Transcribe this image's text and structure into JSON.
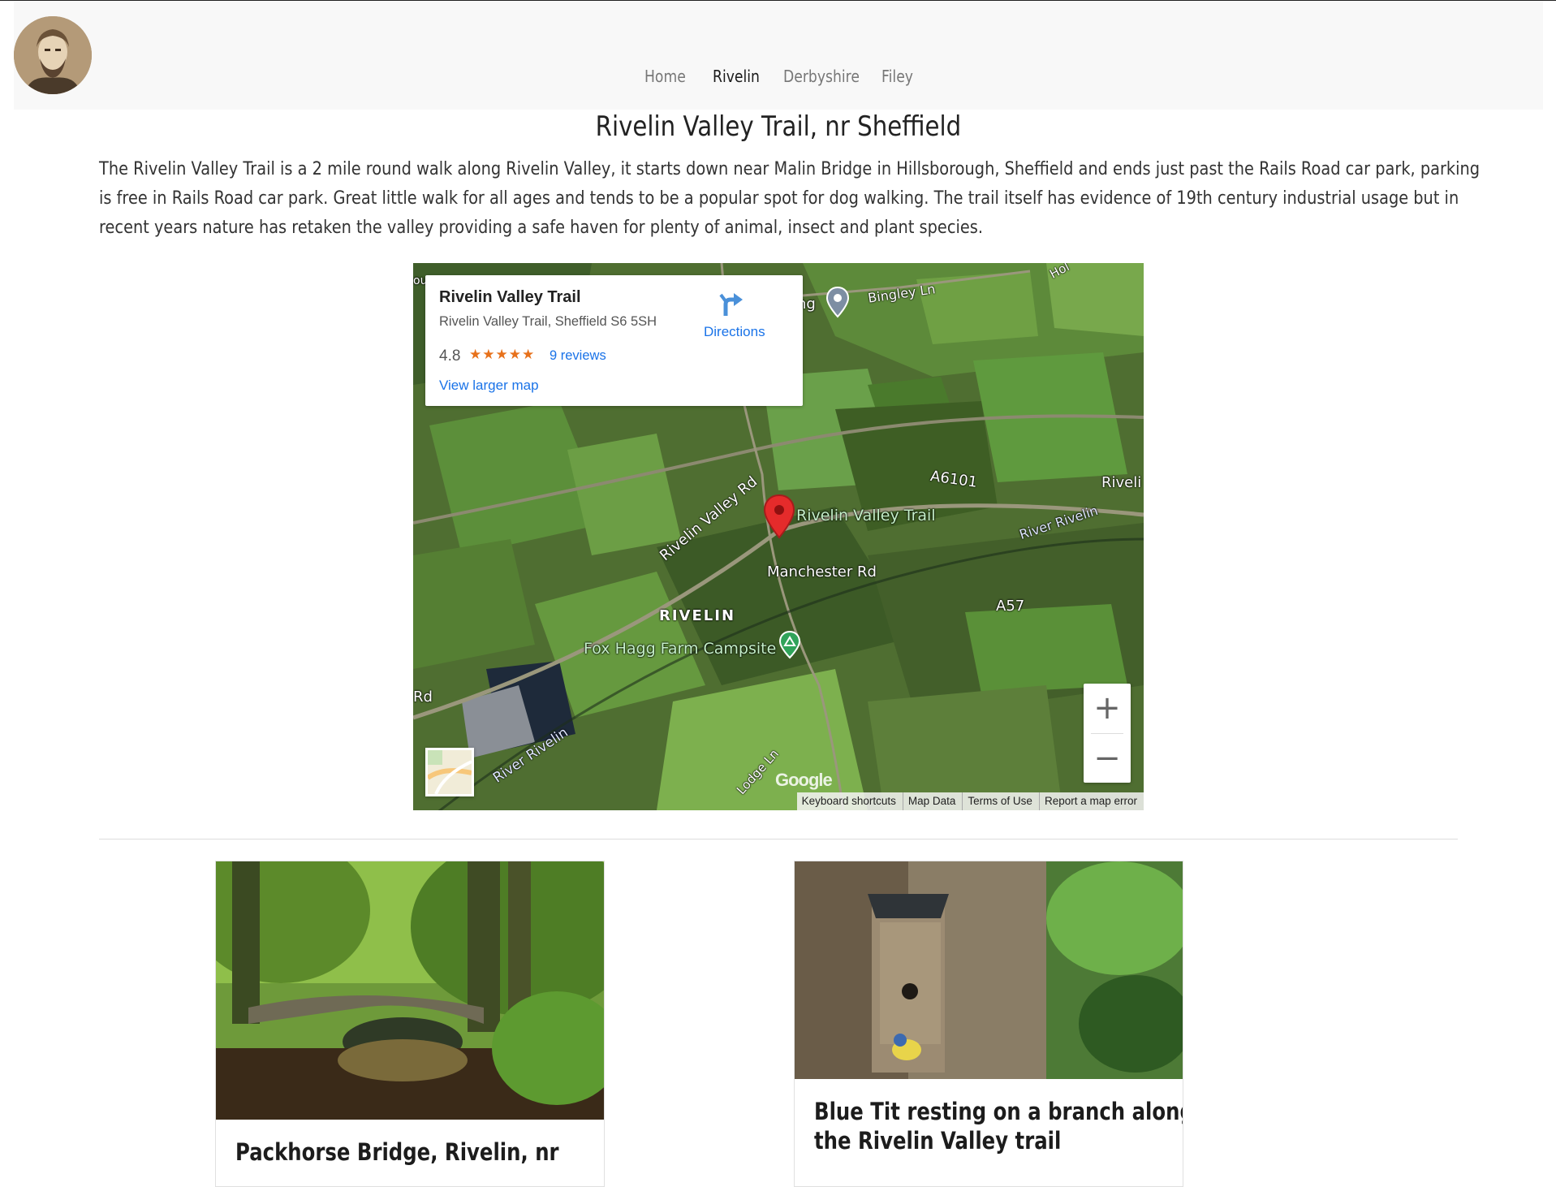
{
  "nav": {
    "items": [
      {
        "label": "Home"
      },
      {
        "label": "Rivelin"
      },
      {
        "label": "Derbyshire"
      },
      {
        "label": "Filey"
      }
    ],
    "active": "Rivelin"
  },
  "page": {
    "title": "Rivelin Valley Trail, nr Sheffield",
    "description": "The Rivelin Valley Trail is a 2 mile round walk along Rivelin Valley, it starts down near Malin Bridge in Hillsborough, Sheffield and ends just past the Rails Road car park, parking is free in Rails Road car park. Great little walk for all ages and tends to be a popular spot for dog walking. The trail itself has evidence of 19th century industrial usage but in recent years nature has retaken the valley providing a safe haven for plenty of animal, insect and plant species."
  },
  "map": {
    "place_name": "Rivelin Valley Trail",
    "address": "Rivelin Valley Trail, Sheffield S6 5SH",
    "rating": "4.8",
    "stars": "★★★★★",
    "reviews": "9 reviews",
    "larger_map": "View larger map",
    "directions": "Directions",
    "zoom_in": "+",
    "zoom_out": "−",
    "logo": "Google",
    "attribution": [
      "Keyboard shortcuts",
      "Map Data",
      "Terms of Use",
      "Report a map error"
    ],
    "labels": {
      "marker": "Rivelin Valley Trail",
      "road1": "Rivelin Valley Rd",
      "road2": "Manchester Rd",
      "area": "RIVELIN",
      "campsite": "Fox Hagg Farm Campsite",
      "a6101": "A6101",
      "a57": "A57",
      "river1": "River Rivelin",
      "river2": "River Rivelin",
      "rivel": "Riveli",
      "bingley": "Bingley Ln",
      "ling": "ling",
      "lodge": "Lodge Ln",
      "rd": "Rd",
      "hol": "Hol",
      "ou": "ou"
    }
  },
  "cards": [
    {
      "caption": "Packhorse Bridge, Rivelin, nr"
    },
    {
      "caption_line1": "Blue Tit resting on a branch along",
      "caption_line2": "the Rivelin Valley trail"
    }
  ]
}
